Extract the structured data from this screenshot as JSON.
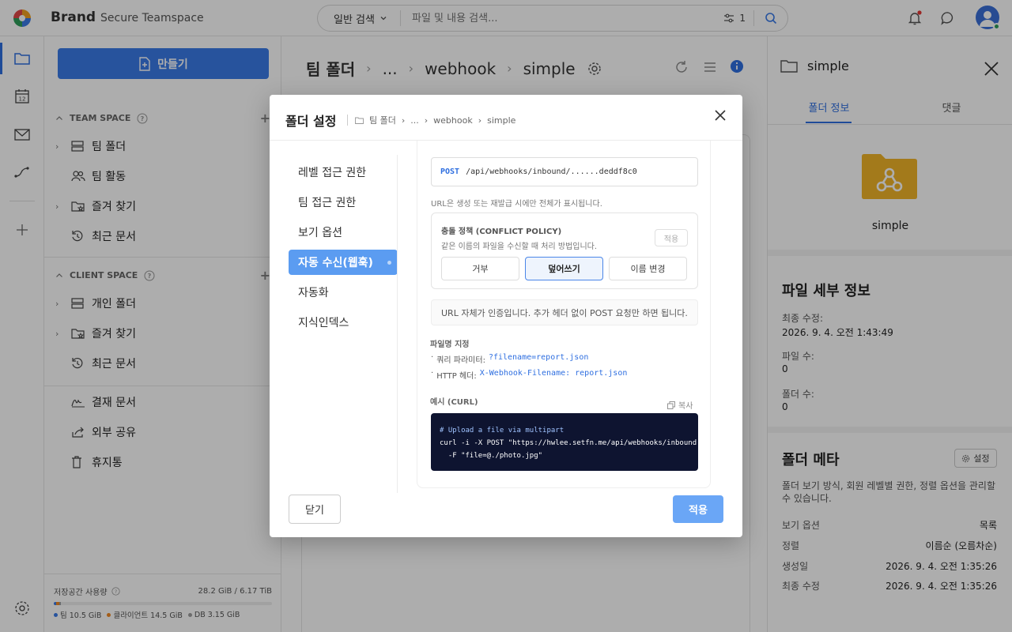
{
  "topbar": {
    "brand": "Brand",
    "brand_sub": "Secure Teamspace",
    "search_mode": "일반 검색",
    "search_placeholder": "파일 및 내용 검색...",
    "filter_count": "1",
    "notification_dot_color": "#e53935"
  },
  "sidebar": {
    "create_label": "만들기",
    "team_space_title": "TEAM SPACE",
    "team_items": [
      {
        "label": "팀 폴더",
        "icon": "server-icon",
        "caret": true
      },
      {
        "label": "팀 활동",
        "icon": "users-icon",
        "caret": false
      },
      {
        "label": "즐겨 찾기",
        "icon": "star-folder-icon",
        "caret": true
      },
      {
        "label": "최근 문서",
        "icon": "history-icon",
        "caret": false
      }
    ],
    "client_space_title": "CLIENT SPACE",
    "client_items": [
      {
        "label": "개인 폴더",
        "icon": "server-icon",
        "caret": true
      },
      {
        "label": "즐겨 찾기",
        "icon": "star-folder-icon",
        "caret": true
      },
      {
        "label": "최근 문서",
        "icon": "history-icon",
        "caret": false
      }
    ],
    "other_items": [
      {
        "label": "결재 문서",
        "icon": "signature-icon"
      },
      {
        "label": "외부 공유",
        "icon": "share-icon"
      },
      {
        "label": "휴지통",
        "icon": "trash-icon"
      }
    ],
    "storage": {
      "label": "저장공간 사용량",
      "value": "28.2 GiB / 6.17 TiB",
      "legend": [
        {
          "label": "팀 10.5 GiB",
          "color": "#3a7be8"
        },
        {
          "label": "클라이언트 14.5 GiB",
          "color": "#f08a24"
        },
        {
          "label": "DB 3.15 GiB",
          "color": "#9e9e9e"
        }
      ]
    }
  },
  "main": {
    "breadcrumb": [
      "팀 폴더",
      "...",
      "webhook",
      "simple"
    ]
  },
  "right_panel": {
    "title": "simple",
    "tabs": [
      "폴더 정보",
      "댓글"
    ],
    "folder_name": "simple",
    "details_title": "파일 세부 정보",
    "details": [
      {
        "label": "최종 수정:",
        "value": "2026. 9. 4. 오전 1:43:49"
      },
      {
        "label": "파일 수:",
        "value": "0"
      },
      {
        "label": "폴더 수:",
        "value": "0"
      }
    ],
    "meta_title": "폴더 메타",
    "meta_button": "설정",
    "meta_desc": "폴더 보기 방식, 회원 레벨별 권한, 정렬 옵션을 관리할 수 있습니다.",
    "meta_rows": [
      {
        "label": "보기 옵션",
        "value": "목록"
      },
      {
        "label": "정렬",
        "value": "이름순 (오름차순)"
      },
      {
        "label": "생성일",
        "value": "2026. 9. 4. 오전 1:35:26"
      },
      {
        "label": "최종 수정",
        "value": "2026. 9. 4. 오전 1:35:26"
      }
    ]
  },
  "modal": {
    "title": "폴더 설정",
    "breadcrumb": [
      "팀 폴더",
      "...",
      "webhook",
      "simple"
    ],
    "nav": [
      "레벨 접근 권한",
      "팀 접근 권한",
      "보기 옵션",
      "자동 수신(웹훅)",
      "자동화",
      "지식인덱스"
    ],
    "active_nav": "자동 수신(웹훅)",
    "url_method": "POST",
    "url_path": "/api/webhooks/inbound/......deddf8c0",
    "url_hint": "URL은 생성 또는 재발급 시에만 전체가 표시됩니다.",
    "conflict_title": "충돌 정책 (CONFLICT POLICY)",
    "conflict_desc": "같은 이름의 파일을 수신할 때 처리 방법입니다.",
    "conflict_apply": "적용",
    "conflict_options": [
      "거부",
      "덮어쓰기",
      "이름 변경"
    ],
    "conflict_selected": "덮어쓰기",
    "auth_info": "URL 자체가 인증입니다. 추가 헤더 없이 POST 요청만 하면 됩니다.",
    "filename_title": "파일명 지정",
    "filename_query_label": "쿼리 파라미터:",
    "filename_query_code": "?filename=report.json",
    "filename_header_label": "HTTP 헤더:",
    "filename_header_code": "X-Webhook-Filename: report.json",
    "example_title": "예시 (CURL)",
    "copy_label": "복사",
    "code_comment": "# Upload a file via multipart",
    "code_line2": "curl -i -X POST \"https://hwlee.setfn.me/api/webhooks/inbound",
    "code_line3": "  -F \"file=@./photo.jpg\"",
    "close_button": "닫기",
    "apply_button": "적용"
  }
}
